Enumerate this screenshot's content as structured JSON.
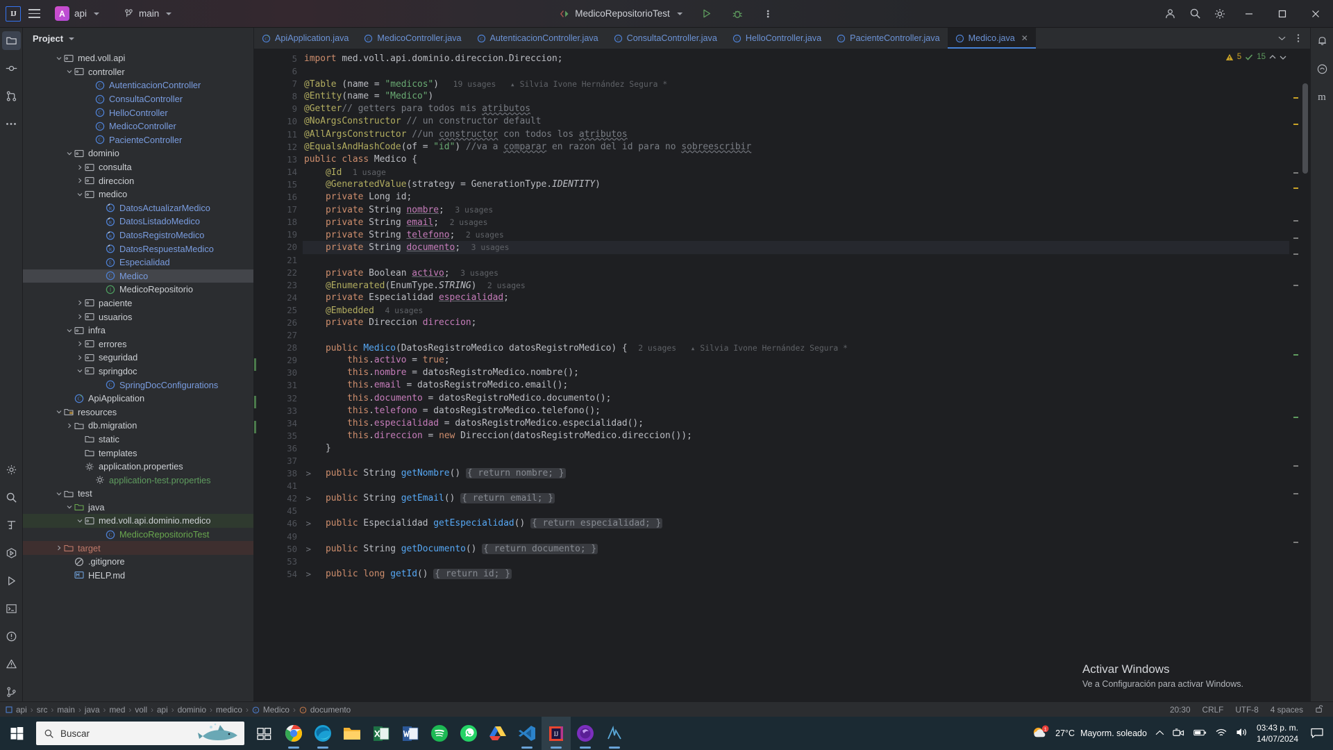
{
  "titlebar": {
    "logo": "IJ",
    "project": "api",
    "project_badge": "A",
    "branch": "main",
    "run_config": "MedicoRepositorioTest",
    "icons": [
      "menu-icon",
      "project-chip",
      "branch-icon",
      "run-config-chip",
      "run-icon",
      "debug-icon",
      "more-icon",
      "account-icon",
      "search-icon",
      "settings-icon"
    ],
    "window_minimize": "—",
    "window_maximize": "□",
    "window_close": "✕"
  },
  "rail_left": [
    "project-icon",
    "commit-icon",
    "pull-requests-icon",
    "more-tool-windows-icon",
    "structure-icon",
    "find-icon",
    "terminal-icon",
    "services-icon",
    "run-icon",
    "todo-icon",
    "problems-icon",
    "version-control-icon"
  ],
  "rail_right": [
    "notifications-icon",
    "ai-assistant-icon",
    "maven-icon"
  ],
  "project_panel": {
    "title": "Project",
    "tree": [
      {
        "indent": 3,
        "arrow": "down",
        "icon": "package",
        "label": "med.voll.api",
        "kind": "pkg"
      },
      {
        "indent": 4,
        "arrow": "down",
        "icon": "package",
        "label": "controller",
        "kind": "pkg"
      },
      {
        "indent": 6,
        "arrow": "none",
        "icon": "class",
        "label": "AutenticacionController",
        "kind": "cls"
      },
      {
        "indent": 6,
        "arrow": "none",
        "icon": "class",
        "label": "ConsultaController",
        "kind": "cls"
      },
      {
        "indent": 6,
        "arrow": "none",
        "icon": "class",
        "label": "HelloController",
        "kind": "cls"
      },
      {
        "indent": 6,
        "arrow": "none",
        "icon": "class",
        "label": "MedicoController",
        "kind": "cls"
      },
      {
        "indent": 6,
        "arrow": "none",
        "icon": "class",
        "label": "PacienteController",
        "kind": "cls"
      },
      {
        "indent": 4,
        "arrow": "down",
        "icon": "package",
        "label": "dominio",
        "kind": "pkg"
      },
      {
        "indent": 5,
        "arrow": "right",
        "icon": "package",
        "label": "consulta",
        "kind": "pkg"
      },
      {
        "indent": 5,
        "arrow": "right",
        "icon": "package",
        "label": "direccion",
        "kind": "pkg"
      },
      {
        "indent": 5,
        "arrow": "down",
        "icon": "package",
        "label": "medico",
        "kind": "pkg"
      },
      {
        "indent": 7,
        "arrow": "none",
        "icon": "record",
        "label": "DatosActualizarMedico",
        "kind": "cls"
      },
      {
        "indent": 7,
        "arrow": "none",
        "icon": "record",
        "label": "DatosListadoMedico",
        "kind": "cls"
      },
      {
        "indent": 7,
        "arrow": "none",
        "icon": "record",
        "label": "DatosRegistroMedico",
        "kind": "cls"
      },
      {
        "indent": 7,
        "arrow": "none",
        "icon": "record",
        "label": "DatosRespuestaMedico",
        "kind": "cls"
      },
      {
        "indent": 7,
        "arrow": "none",
        "icon": "enum",
        "label": "Especialidad",
        "kind": "cls"
      },
      {
        "indent": 7,
        "arrow": "none",
        "icon": "class",
        "label": "Medico",
        "kind": "cls",
        "selected": true
      },
      {
        "indent": 7,
        "arrow": "none",
        "icon": "interface",
        "label": "MedicoRepositorio",
        "kind": "plain"
      },
      {
        "indent": 5,
        "arrow": "right",
        "icon": "package",
        "label": "paciente",
        "kind": "pkg"
      },
      {
        "indent": 5,
        "arrow": "right",
        "icon": "package",
        "label": "usuarios",
        "kind": "pkg"
      },
      {
        "indent": 4,
        "arrow": "down",
        "icon": "package",
        "label": "infra",
        "kind": "pkg"
      },
      {
        "indent": 5,
        "arrow": "right",
        "icon": "package",
        "label": "errores",
        "kind": "pkg"
      },
      {
        "indent": 5,
        "arrow": "right",
        "icon": "package",
        "label": "seguridad",
        "kind": "pkg"
      },
      {
        "indent": 5,
        "arrow": "down",
        "icon": "package",
        "label": "springdoc",
        "kind": "pkg"
      },
      {
        "indent": 7,
        "arrow": "none",
        "icon": "class",
        "label": "SpringDocConfigurations",
        "kind": "cls"
      },
      {
        "indent": 4,
        "arrow": "none",
        "icon": "spring-class",
        "label": "ApiApplication",
        "kind": "plain"
      },
      {
        "indent": 3,
        "arrow": "down",
        "icon": "resources",
        "label": "resources",
        "kind": "plain"
      },
      {
        "indent": 4,
        "arrow": "right",
        "icon": "folder",
        "label": "db.migration",
        "kind": "plain"
      },
      {
        "indent": 5,
        "arrow": "none",
        "icon": "folder",
        "label": "static",
        "kind": "plain"
      },
      {
        "indent": 5,
        "arrow": "none",
        "icon": "folder",
        "label": "templates",
        "kind": "plain"
      },
      {
        "indent": 5,
        "arrow": "none",
        "icon": "properties",
        "label": "application.properties",
        "kind": "plain"
      },
      {
        "indent": 6,
        "arrow": "none",
        "icon": "properties",
        "label": "application-test.properties",
        "kind": "green"
      },
      {
        "indent": 3,
        "arrow": "down",
        "icon": "folder",
        "label": "test",
        "kind": "plain"
      },
      {
        "indent": 4,
        "arrow": "down",
        "icon": "test-source",
        "label": "java",
        "kind": "plain"
      },
      {
        "indent": 5,
        "arrow": "down",
        "icon": "package",
        "label": "med.voll.api.dominio.medico",
        "kind": "plain",
        "rowbg": "green"
      },
      {
        "indent": 7,
        "arrow": "none",
        "icon": "class",
        "label": "MedicoRepositorioTest",
        "kind": "grn2"
      },
      {
        "indent": 3,
        "arrow": "right",
        "icon": "target",
        "label": "target",
        "kind": "red",
        "rowbg": "red"
      },
      {
        "indent": 4,
        "arrow": "none",
        "icon": "gitignore",
        "label": ".gitignore",
        "kind": "plain"
      },
      {
        "indent": 4,
        "arrow": "none",
        "icon": "markdown",
        "label": "HELP.md",
        "kind": "plain"
      }
    ]
  },
  "editor": {
    "tabs": [
      {
        "label": "ApiApplication.java",
        "icon": "spring-class-icon",
        "active": false
      },
      {
        "label": "MedicoController.java",
        "icon": "class-icon",
        "active": false
      },
      {
        "label": "AutenticacionController.java",
        "icon": "class-icon",
        "active": false
      },
      {
        "label": "ConsultaController.java",
        "icon": "class-icon",
        "active": false
      },
      {
        "label": "HelloController.java",
        "icon": "class-icon",
        "active": false
      },
      {
        "label": "PacienteController.java",
        "icon": "class-icon",
        "active": false
      },
      {
        "label": "Medico.java",
        "icon": "class-icon",
        "active": true
      }
    ],
    "inspection": {
      "warnings": "5",
      "passed": "15"
    },
    "first_line_number": 5,
    "lines": [
      {
        "n": 5,
        "html": "<span class=\"k\">import</span> med.voll.api.dominio.direccion.Direccion;"
      },
      {
        "n": 6,
        "html": ""
      },
      {
        "n": 7,
        "html": "<span class=\"an\">@Table</span> (name = <span class=\"st\">\"medicos\"</span>)<span class=\"us\">   19 usages</span><span class=\"us\">   ▴ Silvia Ivone Hernández Segura *</span>"
      },
      {
        "n": 8,
        "html": "<span class=\"an\">@Entity</span>(name = <span class=\"st\">\"Medico\"</span>)"
      },
      {
        "n": 9,
        "html": "<span class=\"an\">@Getter</span><span class=\"cm\">// getters para todos mis <span class=\"wavy\">atributos</span></span>"
      },
      {
        "n": 10,
        "html": "<span class=\"an\">@NoArgsConstructor</span> <span class=\"cm\">// un constructor default</span>"
      },
      {
        "n": 11,
        "html": "<span class=\"an\">@AllArgsConstructor</span> <span class=\"cm\">//un <span class=\"wavy\">constructor</span> con todos los <span class=\"wavy\">atributos</span></span>"
      },
      {
        "n": 12,
        "html": "<span class=\"an\">@EqualsAndHashCode</span>(of = <span class=\"st\">\"id\"</span>) <span class=\"cm\">//va a <span class=\"wavy\">comparar</span> en razon del id para no <span class=\"wavy\">sobreescribir</span></span>"
      },
      {
        "n": 13,
        "html": "<span class=\"k\">public class</span> Medico {"
      },
      {
        "n": 14,
        "html": "    <span class=\"an\">@Id</span>  <span class=\"us\">1 usage</span>"
      },
      {
        "n": 15,
        "html": "    <span class=\"an\">@GeneratedValue</span>(strategy = GenerationType.<span class=\"ity\">IDENTITY</span>)"
      },
      {
        "n": 16,
        "html": "    <span class=\"k\">private</span> Long id;"
      },
      {
        "n": 17,
        "html": "    <span class=\"k\">private</span> String <span class=\"fi ul\">nombre</span>;  <span class=\"us\">3 usages</span>"
      },
      {
        "n": 18,
        "html": "    <span class=\"k\">private</span> String <span class=\"fi ul\">email</span>;  <span class=\"us\">2 usages</span>"
      },
      {
        "n": 19,
        "html": "    <span class=\"k\">private</span> String <span class=\"fi ul\">telefono</span>;  <span class=\"us\">2 usages</span>"
      },
      {
        "n": 20,
        "html": "    <span class=\"k\">private</span> String <span class=\"fi ul\">documento</span>;  <span class=\"us\">3 usages</span>",
        "current": true
      },
      {
        "n": 21,
        "html": ""
      },
      {
        "n": 22,
        "html": "    <span class=\"k\">private</span> Boolean <span class=\"fi ul\">activo</span>;  <span class=\"us\">3 usages</span>"
      },
      {
        "n": 23,
        "html": "    <span class=\"an\">@Enumerated</span>(EnumType.<span class=\"ity\">STRING</span>)  <span class=\"us\">2 usages</span>"
      },
      {
        "n": 24,
        "html": "    <span class=\"k\">private</span> Especialidad <span class=\"fi ul\">especialidad</span>;"
      },
      {
        "n": 25,
        "html": "    <span class=\"an\">@Embedded</span>  <span class=\"us\">4 usages</span>"
      },
      {
        "n": 26,
        "html": "    <span class=\"k\">private</span> Direccion <span class=\"fi\">direccion</span>;"
      },
      {
        "n": 27,
        "html": ""
      },
      {
        "n": 28,
        "html": "    <span class=\"k\">public</span> <span class=\"fn\">Medico</span>(DatosRegistroMedico datosRegistroMedico) {  <span class=\"us\">2 usages</span><span class=\"us\">   ▴ Silvia Ivone Hernández Segura *</span>"
      },
      {
        "n": 29,
        "html": "        <span class=\"k\">this</span>.<span class=\"fi\">activo</span> = <span class=\"k\">true</span>;"
      },
      {
        "n": 30,
        "html": "        <span class=\"k\">this</span>.<span class=\"fi\">nombre</span> = datosRegistroMedico.nombre();"
      },
      {
        "n": 31,
        "html": "        <span class=\"k\">this</span>.<span class=\"fi\">email</span> = datosRegistroMedico.email();"
      },
      {
        "n": 32,
        "html": "        <span class=\"k\">this</span>.<span class=\"fi\">documento</span> = datosRegistroMedico.documento();"
      },
      {
        "n": 33,
        "html": "        <span class=\"k\">this</span>.<span class=\"fi\">telefono</span> = datosRegistroMedico.telefono();"
      },
      {
        "n": 34,
        "html": "        <span class=\"k\">this</span>.<span class=\"fi\">especialidad</span> = datosRegistroMedico.especialidad();"
      },
      {
        "n": 35,
        "html": "        <span class=\"k\">this</span>.<span class=\"fi\">direccion</span> = <span class=\"k\">new</span> Direccion(datosRegistroMedico.direccion());"
      },
      {
        "n": 36,
        "html": "    }"
      },
      {
        "n": 37,
        "html": ""
      },
      {
        "n": 38,
        "html": "    <span class=\"k\">public</span> String <span class=\"fn\">getNombre</span>() <span class=\"inlay\">{ return nombre; }</span>",
        "fold": true
      },
      {
        "n": 41,
        "html": ""
      },
      {
        "n": 42,
        "html": "    <span class=\"k\">public</span> String <span class=\"fn\">getEmail</span>() <span class=\"inlay\">{ return email; }</span>",
        "fold": true
      },
      {
        "n": 45,
        "html": ""
      },
      {
        "n": 46,
        "html": "    <span class=\"k\">public</span> Especialidad <span class=\"fn\">getEspecialidad</span>() <span class=\"inlay\">{ return especialidad; }</span>",
        "fold": true
      },
      {
        "n": 49,
        "html": ""
      },
      {
        "n": 50,
        "html": "    <span class=\"k\">public</span> String <span class=\"fn\">getDocumento</span>() <span class=\"inlay\">{ return documento; }</span>",
        "fold": true
      },
      {
        "n": 53,
        "html": ""
      },
      {
        "n": 54,
        "html": "    <span class=\"k\">public long</span> <span class=\"fn\">getId</span>() <span class=\"inlay\">{ return id; }</span>",
        "fold": true
      }
    ]
  },
  "watermark": {
    "line1": "Activar Windows",
    "line2": "Ve a Configuración para activar Windows."
  },
  "statusbar": {
    "breadcrumb": [
      "api",
      "src",
      "main",
      "java",
      "med",
      "voll",
      "api",
      "dominio",
      "medico",
      "Medico",
      "documento"
    ],
    "caret": "20:30",
    "line_sep": "CRLF",
    "encoding": "UTF-8",
    "indent": "4 spaces",
    "lock_icon": "unlocked-icon"
  },
  "taskbar": {
    "search_placeholder": "Buscar",
    "apps": [
      "task-view-icon",
      "chrome-icon",
      "edge-icon",
      "file-explorer-icon",
      "excel-icon",
      "word-icon",
      "spotify-icon",
      "whatsapp-icon",
      "drive-icon",
      "vscode-icon",
      "intellij-icon",
      "firefox-icon",
      "postman-icon"
    ],
    "weather_temp": "27°C",
    "weather_desc": "Mayorm. soleado",
    "weather_badge": "1",
    "clock_time": "03:43 p. m.",
    "clock_date": "14/07/2024",
    "tray_icons": [
      "chevron-up-icon",
      "meet-icon",
      "battery-icon",
      "wifi-icon",
      "volume-icon"
    ]
  }
}
